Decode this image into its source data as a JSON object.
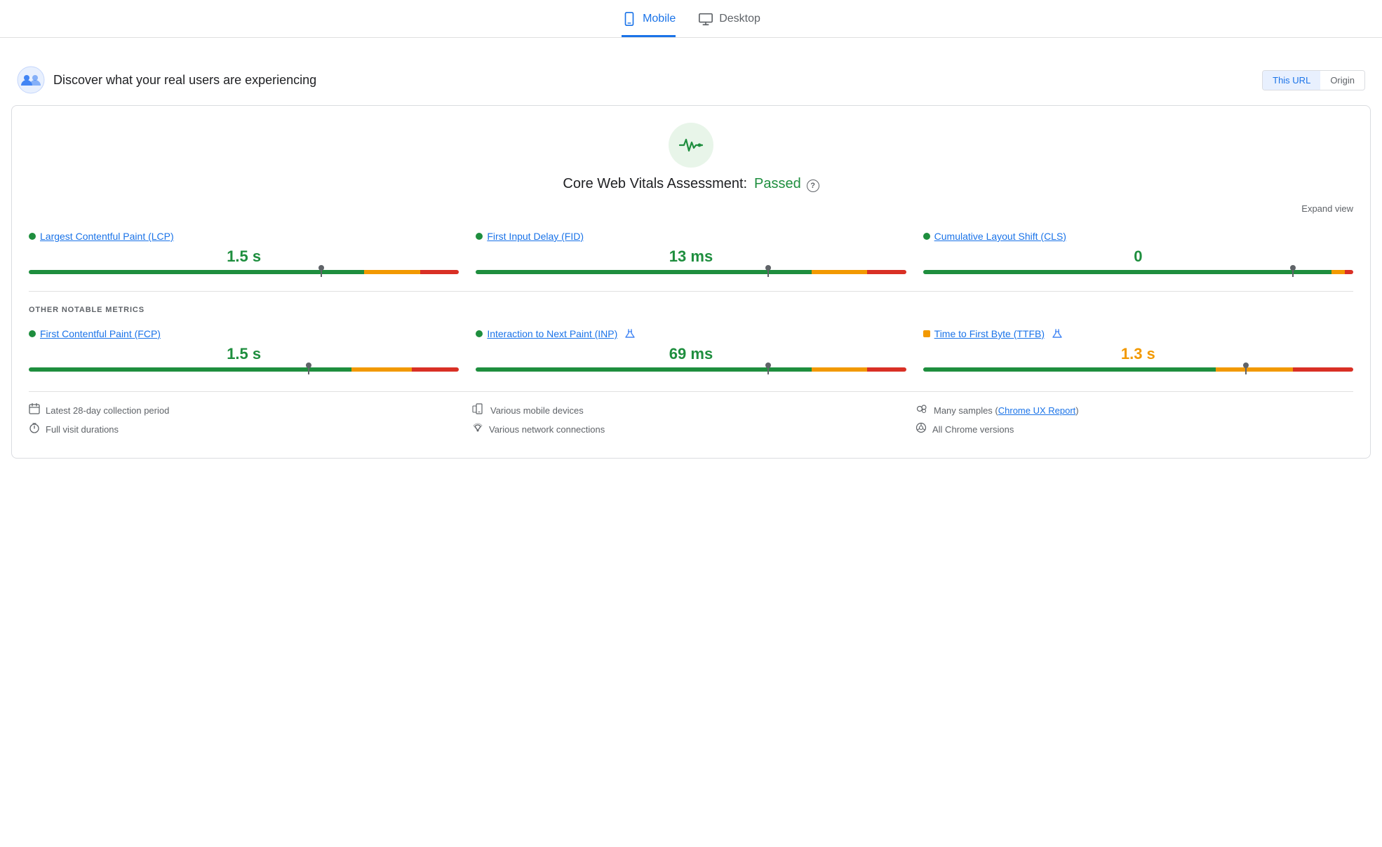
{
  "tabs": {
    "mobile": {
      "label": "Mobile",
      "active": true
    },
    "desktop": {
      "label": "Desktop",
      "active": false
    }
  },
  "section": {
    "title": "Discover what your real users are experiencing",
    "thisUrl": "This URL",
    "origin": "Origin"
  },
  "cwv": {
    "title": "Core Web Vitals Assessment:",
    "status": "Passed",
    "expandView": "Expand view"
  },
  "metrics": {
    "lcp": {
      "label": "Largest Contentful Paint (LCP)",
      "value": "1.5 s",
      "dotColor": "green",
      "gaugeGreen": 78,
      "gaugeOrange": 13,
      "gaugeRed": 9,
      "markerPos": 68
    },
    "fid": {
      "label": "First Input Delay (FID)",
      "value": "13 ms",
      "dotColor": "green",
      "gaugeGreen": 78,
      "gaugeOrange": 13,
      "gaugeRed": 9,
      "markerPos": 68
    },
    "cls": {
      "label": "Cumulative Layout Shift (CLS)",
      "value": "0",
      "dotColor": "green",
      "gaugeGreen": 95,
      "gaugeOrange": 3,
      "gaugeRed": 2,
      "markerPos": 86
    }
  },
  "otherMetrics": {
    "label": "OTHER NOTABLE METRICS",
    "fcp": {
      "label": "First Contentful Paint (FCP)",
      "value": "1.5 s",
      "dotColor": "green",
      "gaugeGreen": 75,
      "gaugeOrange": 14,
      "gaugeRed": 11,
      "markerPos": 65
    },
    "inp": {
      "label": "Interaction to Next Paint (INP)",
      "value": "69 ms",
      "dotColor": "green",
      "experimental": true,
      "gaugeGreen": 78,
      "gaugeOrange": 13,
      "gaugeRed": 9,
      "markerPos": 68
    },
    "ttfb": {
      "label": "Time to First Byte (TTFB)",
      "value": "1.3 s",
      "dotColor": "orange",
      "experimental": true,
      "valueColor": "orange",
      "gaugeGreen": 68,
      "gaugeOrange": 18,
      "gaugeRed": 14,
      "markerPos": 75
    }
  },
  "footer": {
    "col1": [
      {
        "icon": "📅",
        "text": "Latest 28-day collection period"
      },
      {
        "icon": "⏱",
        "text": "Full visit durations"
      }
    ],
    "col2": [
      {
        "icon": "📱",
        "text": "Various mobile devices"
      },
      {
        "icon": "📶",
        "text": "Various network connections"
      }
    ],
    "col3": [
      {
        "icon": "👥",
        "text": "Many samples (",
        "link": "Chrome UX Report",
        "textAfter": ")"
      },
      {
        "icon": "◎",
        "text": "All Chrome versions"
      }
    ]
  }
}
